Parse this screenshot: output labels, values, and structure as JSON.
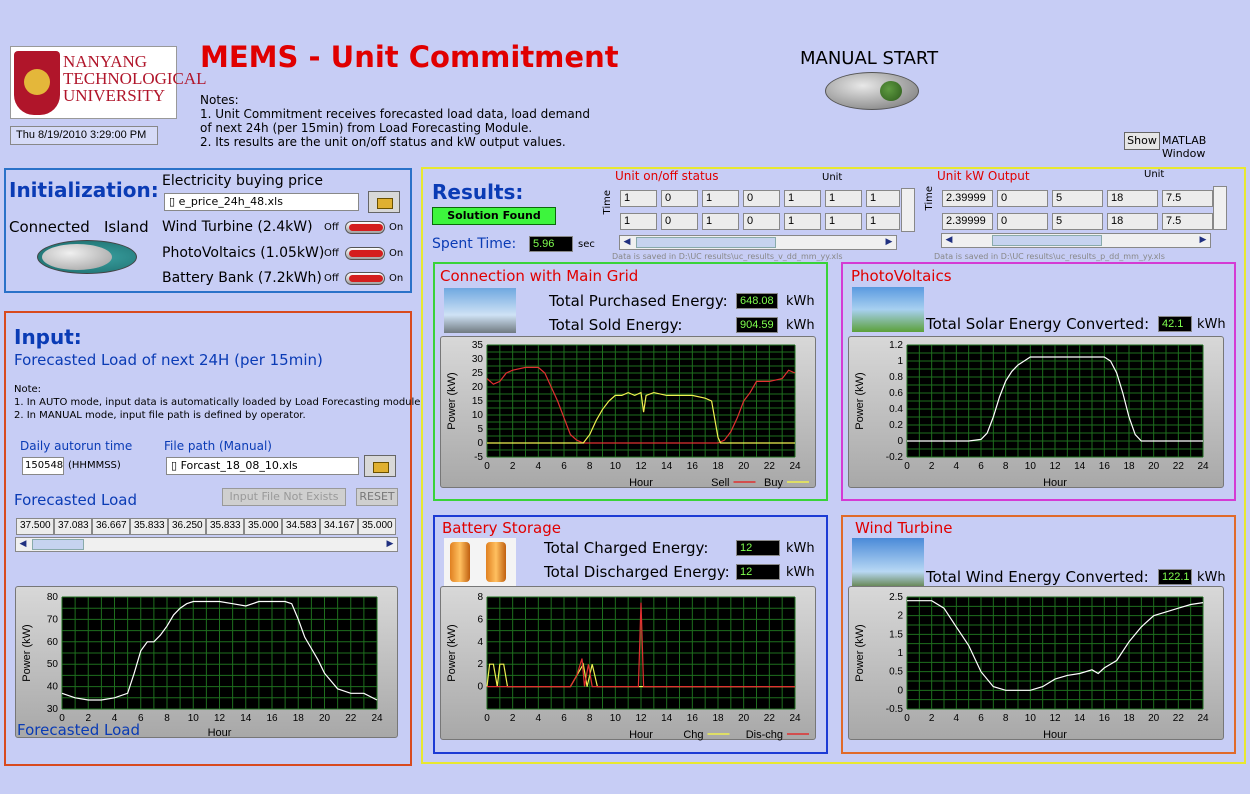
{
  "app": {
    "title": "MEMS - Unit Commitment",
    "logo_text": "NANYANG TECHNOLOGICAL UNIVERSITY",
    "datetime": "Thu 8/19/2010 3:29:00 PM"
  },
  "notes": {
    "heading": "Notes:",
    "line1": "1. Unit Commitment receives forecasted load data, load demand",
    "line2": "of next 24h (per 15min) from Load Forecasting Module.",
    "line3": "2. Its results are the unit on/off status and kW output values."
  },
  "manual": {
    "label": "MANUAL START"
  },
  "matlab": {
    "show_label": "Show",
    "window_label": "MATLAB Window"
  },
  "init": {
    "title": "Initialization:",
    "connected": "Connected",
    "island": "Island",
    "price_label": "Electricity buying price",
    "price_file": "e_price_24h_48.xls",
    "units": [
      {
        "label": "Wind Turbine (2.4kW)",
        "off": "Off",
        "on": "On"
      },
      {
        "label": "PhotoVoltaics (1.05kW)",
        "off": "Off",
        "on": "On"
      },
      {
        "label": "Battery Bank (7.2kWh)",
        "off": "Off",
        "on": "On"
      }
    ]
  },
  "input": {
    "title": "Input:",
    "subtitle": "Forecasted Load of next 24H (per 15min)",
    "note_head": "Note:",
    "note1": "1. In AUTO mode, input data is automatically loaded by Load Forecasting module;",
    "note2": "2. In MANUAL mode, input file path is defined by operator.",
    "autorun_label": "Daily autorun time",
    "autorun_value": "150548",
    "autorun_fmt": "(HHMMSS)",
    "filepath_label": "File path (Manual)",
    "filepath_value": "Forcast_18_08_10.xls",
    "forecast_label": "Forecasted Load",
    "missing_btn": "Input File Not Exists",
    "reset_btn": "RESET",
    "values": [
      "37.500",
      "37.083",
      "36.667",
      "35.833",
      "36.250",
      "35.833",
      "35.000",
      "34.583",
      "34.167",
      "35.000"
    ],
    "chart_caption": "Forecasted Load"
  },
  "results": {
    "title": "Results:",
    "status": "Solution Found",
    "spent_label": "Spent Time:",
    "spent_value": "5.96",
    "spent_unit": "sec",
    "onoff": {
      "title": "Unit on/off status",
      "unit_label": "Unit",
      "time_label": "Time",
      "rows": [
        [
          "1",
          "0",
          "1",
          "0",
          "1",
          "1",
          "1"
        ],
        [
          "1",
          "0",
          "1",
          "0",
          "1",
          "1",
          "1"
        ]
      ],
      "footnote": "Data is saved in D:\\UC results\\uc_results_v_dd_mm_yy.xls"
    },
    "kw": {
      "title": "Unit kW Output",
      "unit_label": "Unit",
      "time_label": "Time",
      "rows": [
        [
          "2.39999",
          "0",
          "5",
          "18",
          "7.5"
        ],
        [
          "2.39999",
          "0",
          "5",
          "18",
          "7.5"
        ]
      ],
      "footnote": "Data is saved in D:\\UC results\\uc_results_p_dd_mm_yy.xls"
    }
  },
  "grid": {
    "title": "Connection with Main Grid",
    "purchased_label": "Total Purchased Energy:",
    "purchased_value": "648.08",
    "sold_label": "Total Sold Energy:",
    "sold_value": "904.59",
    "unit": "kWh",
    "legend_sell": "Sell",
    "legend_buy": "Buy"
  },
  "pv": {
    "title": "PhotoVoltaics",
    "solar_label": "Total Solar Energy Converted:",
    "solar_value": "42.1",
    "unit": "kWh"
  },
  "battery": {
    "title": "Battery Storage",
    "charged_label": "Total Charged Energy:",
    "charged_value": "12",
    "discharged_label": "Total Discharged Energy:",
    "discharged_value": "12",
    "unit": "kWh",
    "legend_chg": "Chg",
    "legend_dischg": "Dis-chg"
  },
  "wind": {
    "title": "Wind Turbine",
    "wind_label": "Total Wind Energy Converted:",
    "wind_value": "122.1",
    "unit": "kWh"
  },
  "colors": {
    "red": "#e00000",
    "blue_title": "#0a3bb5",
    "grid_border": "#39d339",
    "pv_border": "#d43bd4",
    "battery_border": "#1d3bd4",
    "wind_border": "#e06a2a"
  },
  "chart_data": [
    {
      "id": "forecast",
      "type": "line",
      "xlabel": "Hour",
      "ylabel": "Power (kW)",
      "xlim": [
        0,
        24
      ],
      "ylim": [
        30,
        80
      ],
      "xticks": [
        0,
        2,
        4,
        6,
        8,
        10,
        12,
        14,
        16,
        18,
        20,
        22,
        24
      ],
      "yticks": [
        30,
        40,
        50,
        60,
        70,
        80
      ],
      "series": [
        {
          "color": "#ffffff",
          "x": [
            0,
            1,
            2,
            3,
            4,
            5,
            5.5,
            6,
            6.5,
            7,
            7.5,
            8,
            8.5,
            9,
            9.5,
            10,
            11,
            12,
            13,
            14,
            15,
            15.5,
            16,
            17,
            17.5,
            18,
            18.5,
            19,
            19.5,
            20,
            21,
            22,
            23,
            24
          ],
          "y": [
            37,
            35,
            34,
            34,
            35,
            37,
            46,
            56,
            60,
            60,
            63,
            67,
            72,
            75,
            77,
            78,
            78,
            78,
            77,
            76,
            78,
            78,
            78,
            78,
            77,
            70,
            62,
            57,
            52,
            46,
            39,
            37,
            37,
            34
          ]
        }
      ]
    },
    {
      "id": "grid",
      "type": "line",
      "xlabel": "Hour",
      "ylabel": "Power (kW)",
      "xlim": [
        0,
        24
      ],
      "ylim": [
        -5,
        35
      ],
      "xticks": [
        0,
        2,
        4,
        6,
        8,
        10,
        12,
        14,
        16,
        18,
        20,
        22,
        24
      ],
      "yticks": [
        -5,
        0,
        5,
        10,
        15,
        20,
        25,
        30,
        35
      ],
      "series": [
        {
          "name": "Sell",
          "color": "#e03030",
          "x": [
            0,
            0.5,
            1,
            1.5,
            2,
            3,
            4,
            4.5,
            5,
            5.5,
            6,
            6.5,
            7,
            7.5,
            8,
            18,
            18.5,
            19,
            19.5,
            20,
            20.5,
            21,
            22,
            23,
            23.5,
            24
          ],
          "y": [
            23,
            21,
            22,
            25,
            26,
            27,
            27,
            25,
            20,
            15,
            9,
            3,
            1,
            0,
            0,
            0,
            1,
            4,
            9,
            15,
            18,
            22,
            22,
            23,
            26,
            25
          ]
        },
        {
          "name": "Buy",
          "color": "#f0f050",
          "x": [
            0,
            7,
            7.5,
            8,
            8.5,
            9,
            9.5,
            10,
            10.5,
            11,
            11.5,
            12,
            12.2,
            12.4,
            13,
            14,
            15,
            16,
            17,
            17.5,
            18,
            18.2,
            24
          ],
          "y": [
            0,
            0,
            0,
            3,
            8,
            12,
            15,
            17,
            17,
            18,
            17,
            18,
            11,
            17,
            18,
            17,
            17,
            17,
            16,
            15,
            2,
            0,
            0
          ]
        }
      ]
    },
    {
      "id": "pv",
      "type": "line",
      "xlabel": "Hour",
      "ylabel": "Power (kW)",
      "xlim": [
        0,
        24
      ],
      "ylim": [
        -0.2,
        1.2
      ],
      "xticks": [
        0,
        2,
        4,
        6,
        8,
        10,
        12,
        14,
        16,
        18,
        20,
        22,
        24
      ],
      "yticks": [
        -0.2,
        0,
        0.2,
        0.4,
        0.6,
        0.8,
        1,
        1.2
      ],
      "series": [
        {
          "color": "#ffffff",
          "x": [
            0,
            5,
            6,
            6.5,
            7,
            7.5,
            8,
            8.5,
            9,
            9.5,
            10,
            11,
            12,
            13,
            14,
            15,
            16,
            16.5,
            17,
            17.5,
            18,
            18.5,
            19,
            24
          ],
          "y": [
            0,
            0,
            0.02,
            0.1,
            0.3,
            0.55,
            0.75,
            0.87,
            0.95,
            1.0,
            1.05,
            1.05,
            1.05,
            1.05,
            1.05,
            1.05,
            1.05,
            1.0,
            0.85,
            0.6,
            0.3,
            0.08,
            0,
            0
          ]
        }
      ]
    },
    {
      "id": "battery",
      "type": "line",
      "xlabel": "Hour",
      "ylabel": "Power (kW)",
      "xlim": [
        0,
        24
      ],
      "ylim": [
        -2,
        8
      ],
      "xticks": [
        0,
        2,
        4,
        6,
        8,
        10,
        12,
        14,
        16,
        18,
        20,
        22,
        24
      ],
      "yticks": [
        0,
        2,
        4,
        6,
        8
      ],
      "series": [
        {
          "name": "Chg",
          "color": "#f0f050",
          "x": [
            0,
            0.2,
            0.5,
            0.8,
            1,
            1.3,
            1.6,
            2,
            6.5,
            7,
            7.5,
            7.8,
            8.2,
            8.6,
            9,
            24
          ],
          "y": [
            0,
            2,
            2,
            0,
            2,
            2,
            0,
            0,
            0,
            1,
            2,
            0,
            2,
            0,
            0,
            0
          ]
        },
        {
          "name": "Dis-chg",
          "color": "#e03030",
          "x": [
            0,
            6.5,
            7,
            7.4,
            7.6,
            7.9,
            8.2,
            11.8,
            12,
            12.2,
            24
          ],
          "y": [
            0,
            0,
            1,
            2.5,
            0,
            2,
            0,
            0,
            7.5,
            0,
            0
          ]
        }
      ]
    },
    {
      "id": "wind",
      "type": "line",
      "xlabel": "Hour",
      "ylabel": "Power (kW)",
      "xlim": [
        0,
        24
      ],
      "ylim": [
        -0.5,
        2.5
      ],
      "xticks": [
        0,
        2,
        4,
        6,
        8,
        10,
        12,
        14,
        16,
        18,
        20,
        22,
        24
      ],
      "yticks": [
        -0.5,
        0,
        0.5,
        1,
        1.5,
        2,
        2.5
      ],
      "series": [
        {
          "color": "#ffffff",
          "x": [
            0,
            1,
            2,
            3,
            4,
            5,
            6,
            7,
            8,
            9,
            10,
            11,
            12,
            13,
            14,
            15,
            15.5,
            16,
            17,
            18,
            19,
            20,
            21,
            22,
            23,
            24
          ],
          "y": [
            2.4,
            2.4,
            2.4,
            2.2,
            1.7,
            1.2,
            0.5,
            0.1,
            0,
            0,
            0,
            0.1,
            0.3,
            0.4,
            0.45,
            0.55,
            0.45,
            0.6,
            0.8,
            1.3,
            1.7,
            2.0,
            2.1,
            2.2,
            2.3,
            2.35
          ]
        }
      ]
    }
  ]
}
